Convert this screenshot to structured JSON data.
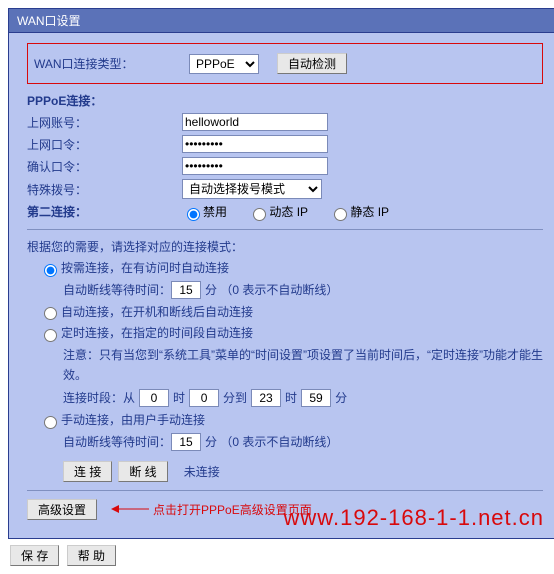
{
  "title": "WAN口设置",
  "wan_type": {
    "label": "WAN口连接类型：",
    "value": "PPPoE",
    "detect_btn": "自动检测"
  },
  "section_label": "PPPoE连接：",
  "account": {
    "label": "上网账号：",
    "value": "helloworld"
  },
  "password": {
    "label": "上网口令：",
    "value": "•••••••••"
  },
  "confirm_pwd": {
    "label": "确认口令：",
    "value": "•••••••••"
  },
  "special_dial": {
    "label": "特殊拨号：",
    "value": "自动选择拨号模式"
  },
  "second_conn": {
    "label": "第二连接：",
    "opts": {
      "disable": "禁用",
      "dynamic": "动态 IP",
      "static": "静态 IP"
    }
  },
  "mode_intro": "根据您的需要，请选择对应的连接模式：",
  "modes": {
    "ondemand": "按需连接，在有访问时自动连接",
    "ondemand_wait_label": "自动断线等待时间：",
    "ondemand_wait_val": "15",
    "ondemand_wait_suffix": "分 （0 表示不自动断线）",
    "auto": "自动连接，在开机和断线后自动连接",
    "timed": "定时连接，在指定的时间段自动连接",
    "timed_note": "注意：只有当您到“系统工具”菜单的“时间设置”项设置了当前时间后，“定时连接”功能才能生效。",
    "time_range_label": "连接时段：从",
    "t_from_h": "0",
    "t_from_m": "0",
    "t_between": "分到",
    "t_to_h": "23",
    "t_to_m": "59",
    "t_suffix": "分",
    "hour_word": "时",
    "manual": "手动连接，由用户手动连接",
    "manual_wait_label": "自动断线等待时间：",
    "manual_wait_val": "15",
    "manual_wait_suffix": "分 （0 表示不自动断线）"
  },
  "buttons": {
    "connect": "连 接",
    "disconnect": "断 线",
    "status": "未连接",
    "advanced": "高级设置",
    "save": "保 存",
    "help": "帮 助"
  },
  "callout": "点击打开PPPoE高级设置页面",
  "watermark": "www.192-168-1-1.net.cn"
}
